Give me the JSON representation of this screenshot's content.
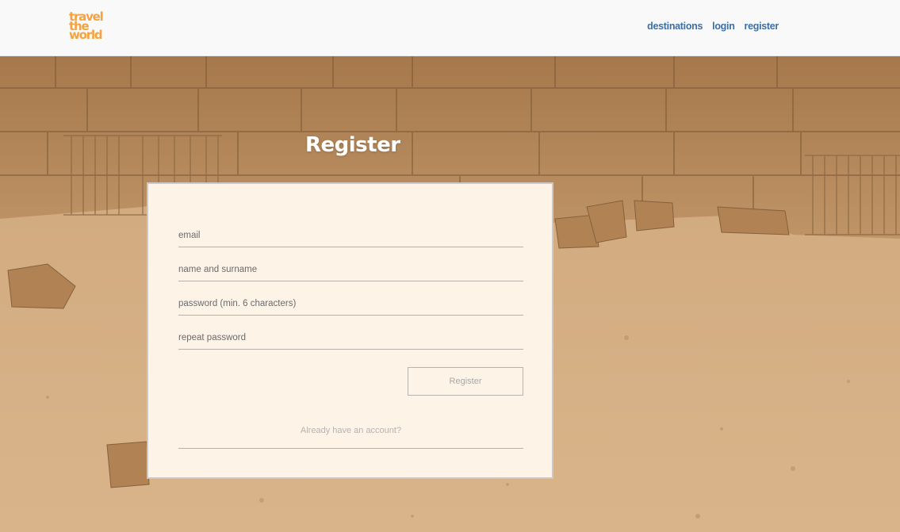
{
  "header": {
    "logo_lines": [
      "travel",
      "the",
      "world"
    ],
    "nav": [
      "destinations",
      "login",
      "register"
    ]
  },
  "form": {
    "title": "Register",
    "fields": [
      {
        "placeholder": "email"
      },
      {
        "placeholder": "name and surname"
      },
      {
        "placeholder": "password (min. 6 characters)"
      },
      {
        "placeholder": "repeat password"
      }
    ],
    "submit_label": "Register",
    "login_link": "Already have an account?"
  },
  "colors": {
    "brand": "#f4a340",
    "nav": "#3c6fa6",
    "card": "#fef3e7"
  }
}
